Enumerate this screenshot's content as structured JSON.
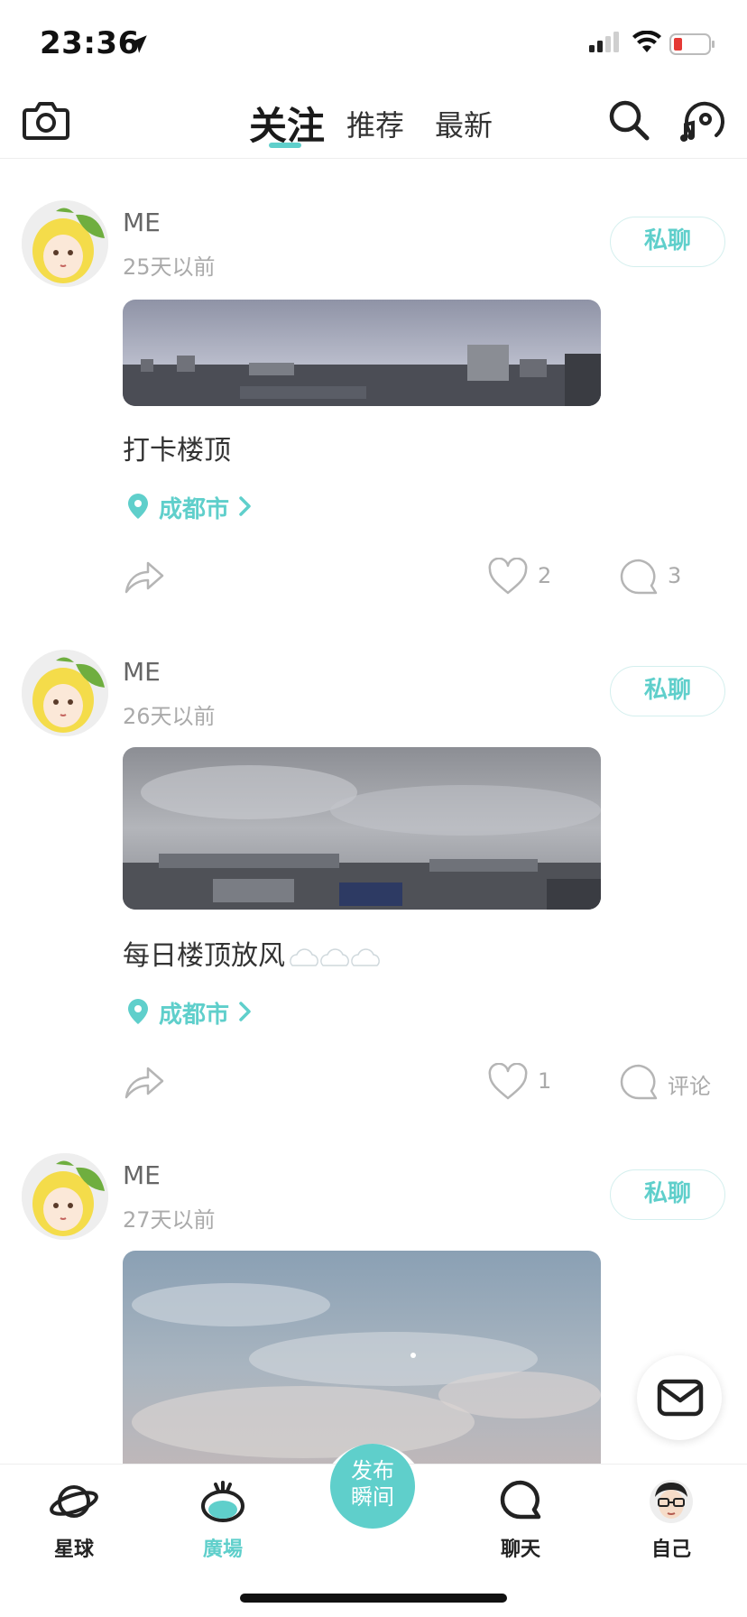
{
  "status_bar": {
    "time": "23:36"
  },
  "top_nav": {
    "tabs": [
      "关注",
      "推荐",
      "最新"
    ],
    "active_tab": "关注",
    "accent_color": "#5fcfcb"
  },
  "posts": [
    {
      "name": "ME",
      "time": "25天以前",
      "chat_label": "私聊",
      "text": "打卡楼顶",
      "location": "成都市",
      "likes": "2",
      "comments": "3"
    },
    {
      "name": "ME",
      "time": "26天以前",
      "chat_label": "私聊",
      "text": "每日楼顶放风",
      "location": "成都市",
      "likes": "1",
      "comments": "评论"
    },
    {
      "name": "ME",
      "time": "27天以前",
      "chat_label": "私聊"
    }
  ],
  "tabbar": {
    "items": [
      {
        "label": "星球",
        "icon": "planet-icon"
      },
      {
        "label": "廣場",
        "icon": "plaza-icon"
      },
      {
        "label": "聊天",
        "icon": "chat-bubble-icon"
      },
      {
        "label": "自己",
        "icon": "profile-avatar-icon"
      }
    ],
    "active": "廣場",
    "publish": {
      "line1": "发布",
      "line2": "瞬间"
    }
  }
}
